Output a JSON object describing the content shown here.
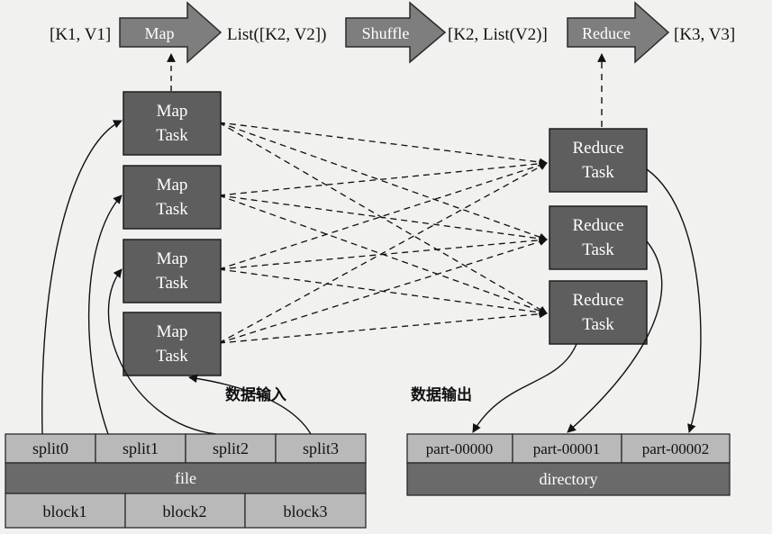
{
  "pipeline": {
    "k1v1": "[K1, V1]",
    "map": "Map",
    "list_k2v2": "List([K2, V2])",
    "shuffle": "Shuffle",
    "k2_list_v2": "[K2, List(V2)]",
    "reduce": "Reduce",
    "k3v3": "[K3, V3]"
  },
  "map_tasks": [
    {
      "line1": "Map",
      "line2": "Task"
    },
    {
      "line1": "Map",
      "line2": "Task"
    },
    {
      "line1": "Map",
      "line2": "Task"
    },
    {
      "line1": "Map",
      "line2": "Task"
    }
  ],
  "reduce_tasks": [
    {
      "line1": "Reduce",
      "line2": "Task"
    },
    {
      "line1": "Reduce",
      "line2": "Task"
    },
    {
      "line1": "Reduce",
      "line2": "Task"
    }
  ],
  "captions": {
    "input": "数据输入",
    "output": "数据输出"
  },
  "input_table": {
    "splits": [
      "split0",
      "split1",
      "split2",
      "split3"
    ],
    "file": "file",
    "blocks": [
      "block1",
      "block2",
      "block3"
    ]
  },
  "output_table": {
    "parts": [
      "part-00000",
      "part-00001",
      "part-00002"
    ],
    "directory": "directory"
  },
  "colors": {
    "task_fill": "#5e5e5e",
    "arrow_fill": "#7e7e7e",
    "cell_light": "#b9b9b9",
    "cell_dark": "#6a6a6a",
    "background": "#f1f1f0"
  }
}
